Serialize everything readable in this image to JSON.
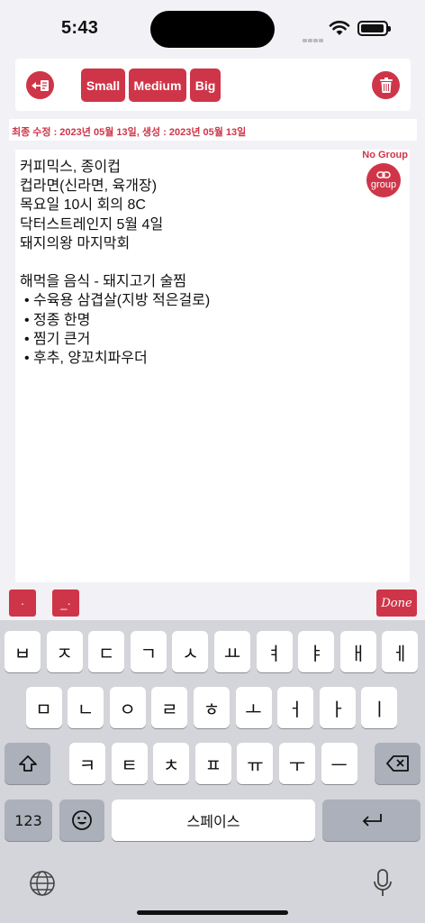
{
  "status": {
    "time": "5:43"
  },
  "toolbar": {
    "small_label": "Small",
    "medium_label": "Medium",
    "big_label": "Big"
  },
  "dates": {
    "text": "최종 수정 : 2023년 05월 13일, 생성 : 2023년 05월 13일"
  },
  "note": {
    "group_label": "No Group",
    "group_button_label": "group",
    "lines": [
      "커피믹스, 종이컵",
      "컵라면(신라면, 육개장)",
      "목요일 10시 회의 8C",
      "닥터스트레인지 5월 4일",
      "돼지의왕 마지막회",
      "",
      "해먹을 음식 - 돼지고기 술찜",
      "• 수육용 삼겹살(지방 적은걸로)",
      "• 정종 한명",
      "• 찜기 큰거",
      "• 후추, 양꼬치파우더"
    ]
  },
  "accessory": {
    "dot_label": "·",
    "underscore_label": "_·",
    "done_label": "Done"
  },
  "keyboard": {
    "row1": [
      "ㅂ",
      "ㅈ",
      "ㄷ",
      "ㄱ",
      "ㅅ",
      "ㅛ",
      "ㅕ",
      "ㅑ",
      "ㅐ",
      "ㅔ"
    ],
    "row2": [
      "ㅁ",
      "ㄴ",
      "ㅇ",
      "ㄹ",
      "ㅎ",
      "ㅗ",
      "ㅓ",
      "ㅏ",
      "ㅣ"
    ],
    "row3": [
      "ㅋ",
      "ㅌ",
      "ㅊ",
      "ㅍ",
      "ㅠ",
      "ㅜ",
      "ㅡ"
    ],
    "numbers_label": "123",
    "space_label": "스페이스"
  },
  "colors": {
    "accent": "#cf3548",
    "keyboard_bg": "#d3d5da"
  },
  "icons": [
    "back-edit-icon",
    "trash-icon",
    "link-icon",
    "shift-icon",
    "backspace-icon",
    "emoji-icon",
    "return-icon",
    "globe-icon",
    "mic-icon",
    "wifi-icon",
    "battery-icon"
  ]
}
